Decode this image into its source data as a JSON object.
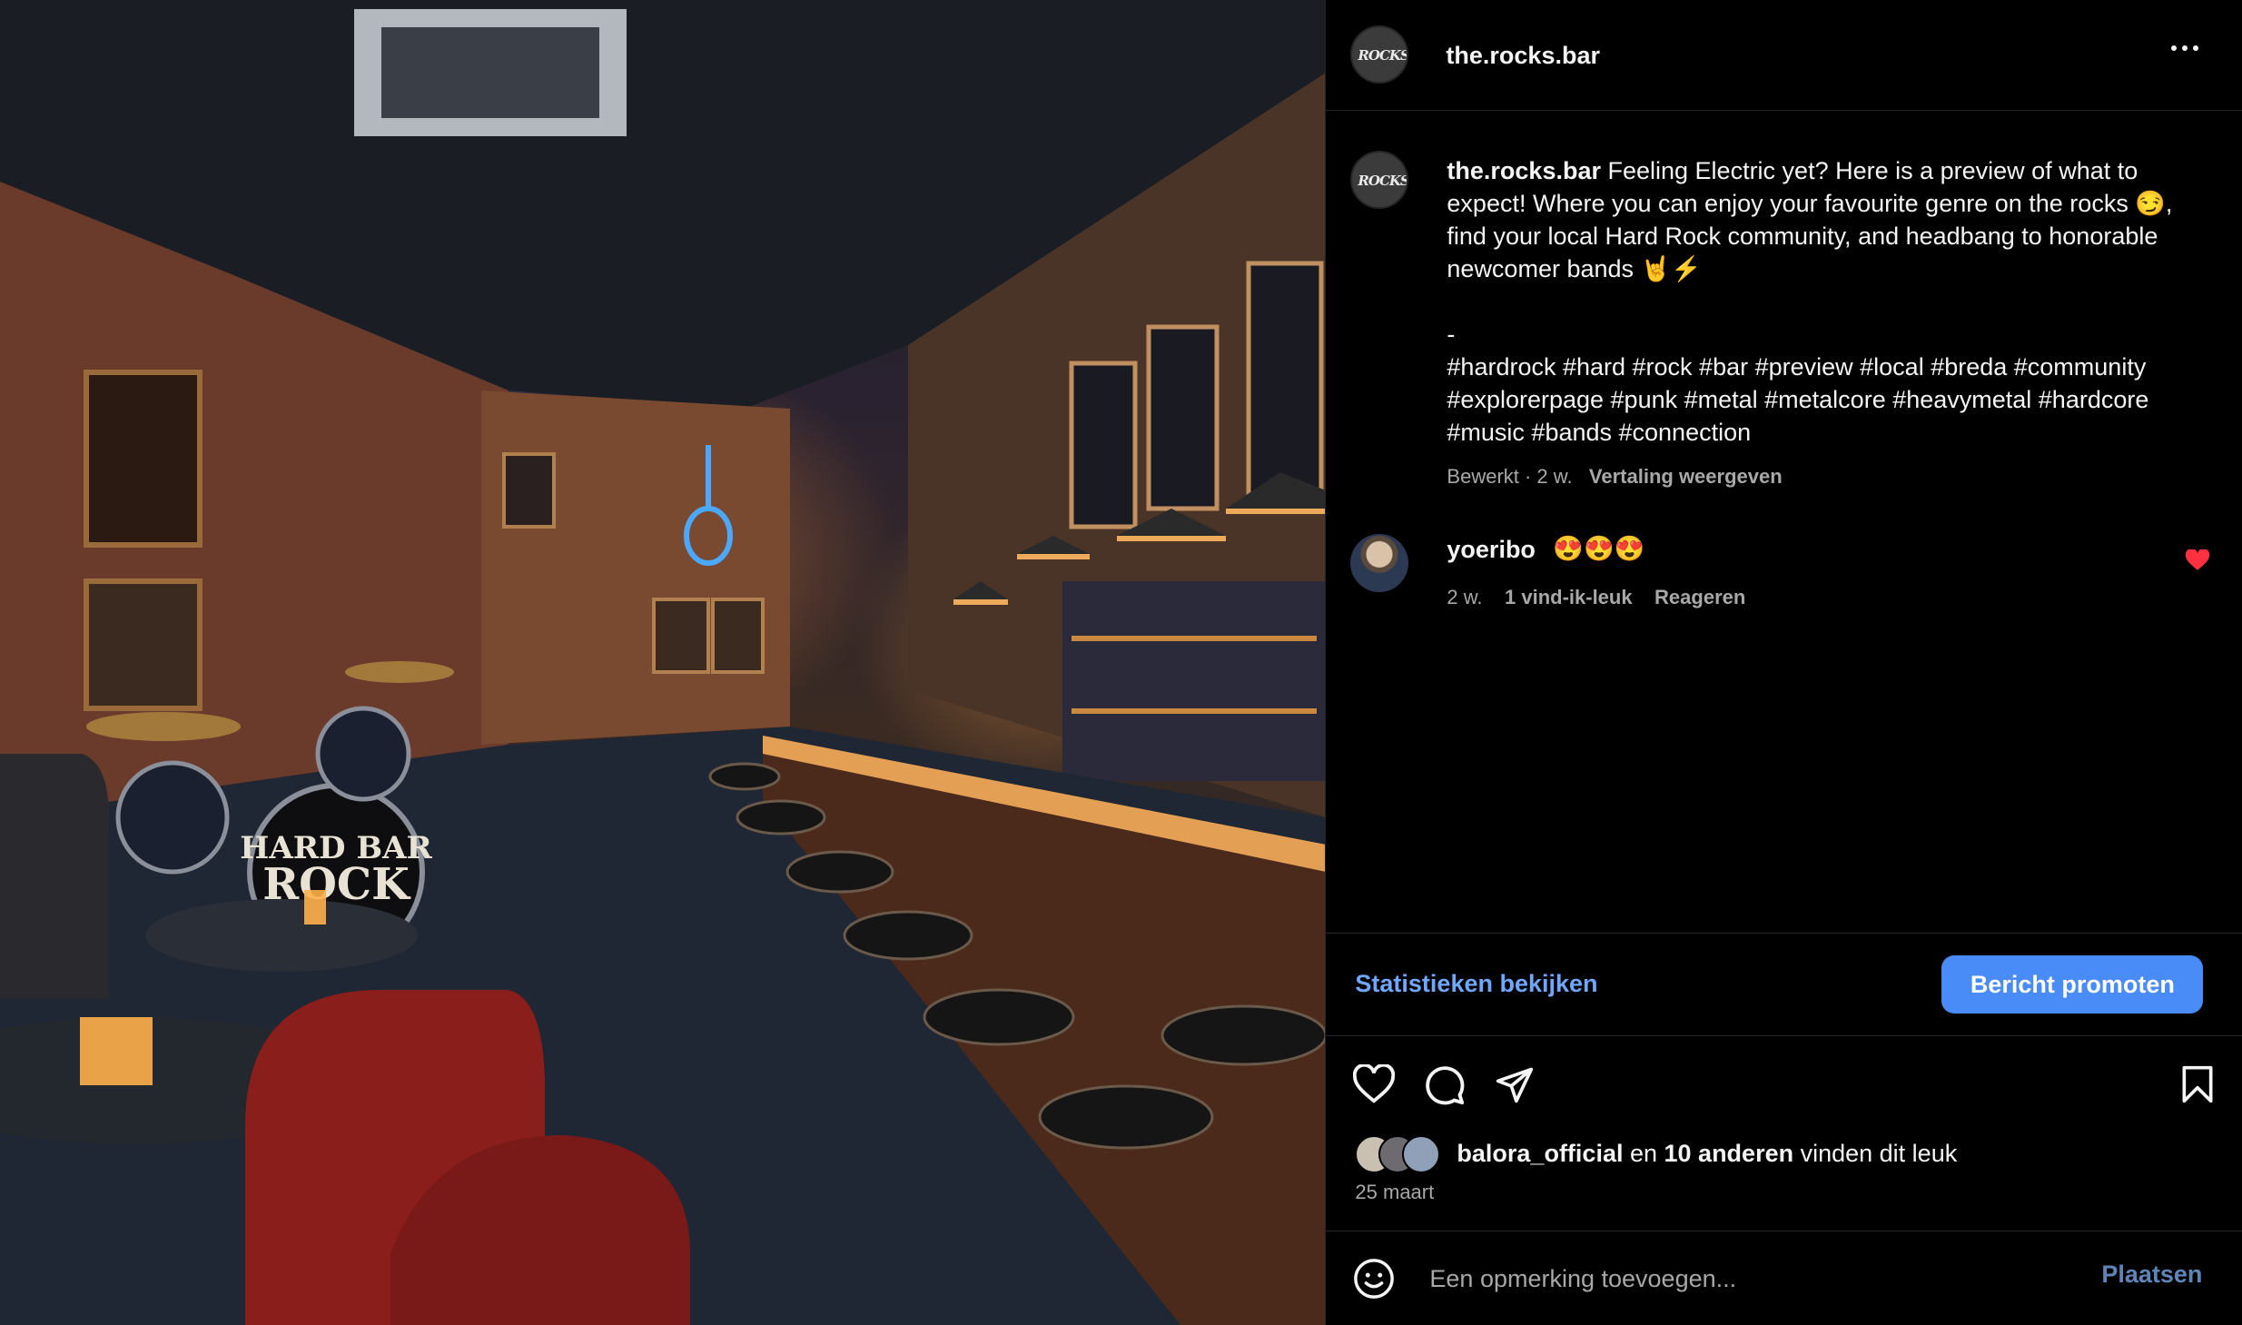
{
  "post": {
    "image_alt": "Hard rock bar interior with drum kit and bar stools",
    "drum_text_1": "HARD BAR",
    "drum_text_2": "ROCK"
  },
  "header": {
    "username": "the.rocks.bar",
    "avatar_logo": "ROCKS",
    "more_icon": "more-horizontal-icon"
  },
  "caption": {
    "username": "the.rocks.bar",
    "text": " Feeling Electric yet? Here is a preview of what to expect! Where you can enjoy your favourite genre on the rocks 😏, find your local Hard Rock community, and headbang to honorable newcomer bands 🤘⚡\n\n-\n#hardrock #hard #rock #bar #preview #local #breda #community #explorerpage #punk #metal #metalcore #heavymetal #hardcore #music #bands #connection",
    "edited": "Bewerkt · 2 w.",
    "translate": "Vertaling weergeven"
  },
  "comment": {
    "username": "yoeribo",
    "text": "😍😍😍",
    "age": "2 w.",
    "likes": "1 vind-ik-leuk",
    "reply": "Reageren"
  },
  "insights": {
    "stats_link": "Statistieken bekijken",
    "promote_button": "Bericht promoten"
  },
  "actions": {
    "icons": [
      "heart-icon",
      "comment-icon",
      "share-icon",
      "bookmark-icon"
    ]
  },
  "likes": {
    "user": "balora_official",
    "connector": " en ",
    "others": "10 anderen",
    "suffix": " vinden dit leuk"
  },
  "date": "25 maart",
  "add_comment": {
    "placeholder": "Een opmerking toevoegen...",
    "post_button": "Plaatsen"
  },
  "colors": {
    "accent": "#4a8cf7",
    "link": "#6fa7ff",
    "like_red": "#ff3040",
    "muted": "#a8a8a8"
  }
}
